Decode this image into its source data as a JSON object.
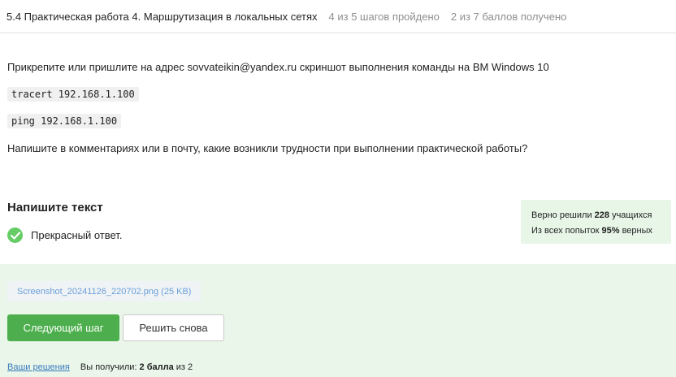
{
  "header": {
    "title": "5.4 Практическая работа 4. Маршрутизация в локальных сетях",
    "steps_progress": "4 из 5 шагов пройдено",
    "points_progress": "2 из 7 баллов  получено"
  },
  "task": {
    "instruction": "Прикрепите или пришлите на адрес sovvateikin@yandex.ru скриншот выполнения команды на ВМ Windows 10",
    "commands": [
      "tracert 192.168.1.100",
      "ping 192.168.1.100"
    ],
    "question": "Напишите в комментариях или в почту, какие возникли трудности при выполнении практической работы?"
  },
  "answer": {
    "heading": "Напишите текст",
    "feedback": "Прекрасный ответ.",
    "feedback_icon": "check-circle-icon"
  },
  "stats": {
    "line1_prefix": "Верно решили ",
    "line1_value": "228",
    "line1_suffix": " учащихся",
    "line2_prefix": "Из всех попыток ",
    "line2_value": "95%",
    "line2_suffix": " верных"
  },
  "result": {
    "attachment": "Screenshot_20241126_220702.png (25 KB)",
    "next_button": "Следующий шаг",
    "retry_button": "Решить снова",
    "solutions_link": "Ваши решения",
    "score_prefix": "Вы получили: ",
    "score_value": "2 балла",
    "score_suffix": " из 2"
  },
  "colors": {
    "accent_green": "#4cae4c",
    "success_bg": "#e9f6e9",
    "link_blue": "#3b7bbf"
  }
}
